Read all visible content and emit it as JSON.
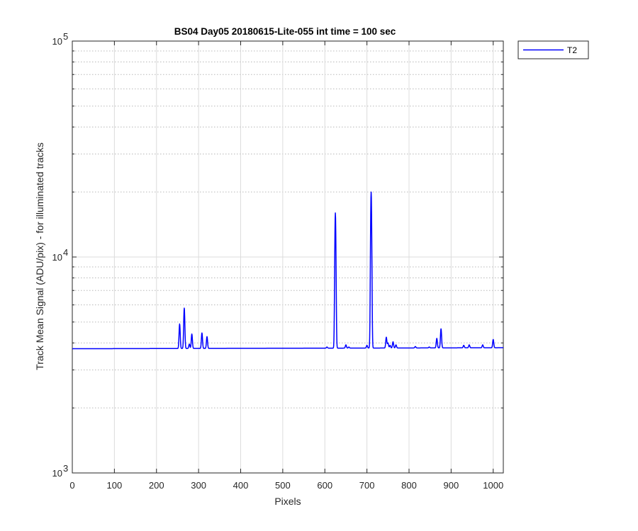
{
  "chart_data": {
    "type": "line",
    "title": "BS04 Day05 20180615-Lite-055 int time = 100 sec",
    "xlabel": "Pixels",
    "ylabel": "Track Mean Signal (ADU/pix) - for illuminated tracks",
    "xlim": [
      0,
      1024
    ],
    "ylim": [
      1000,
      100000
    ],
    "yscale": "log",
    "x_ticks": [
      0,
      100,
      200,
      300,
      400,
      500,
      600,
      700,
      800,
      900,
      1000
    ],
    "x_tick_labels": [
      "0",
      "100",
      "200",
      "300",
      "400",
      "500",
      "600",
      "700",
      "800",
      "900",
      "1000"
    ],
    "y_major_ticks": [
      1000,
      10000,
      100000
    ],
    "y_tick_labels": [
      {
        "base": "10",
        "exp": "3"
      },
      {
        "base": "10",
        "exp": "4"
      },
      {
        "base": "10",
        "exp": "5"
      }
    ],
    "grid": true,
    "minor_grid": true,
    "legend_position": "outside-top-right",
    "series": [
      {
        "name": "T2",
        "color": "#0000ff",
        "baseline_start": 3760,
        "baseline_end": 3800,
        "peaks": [
          {
            "x": 255,
            "y": 4900
          },
          {
            "x": 266,
            "y": 5800
          },
          {
            "x": 278,
            "y": 3950
          },
          {
            "x": 284,
            "y": 4400
          },
          {
            "x": 308,
            "y": 4450
          },
          {
            "x": 320,
            "y": 4280
          },
          {
            "x": 605,
            "y": 3830
          },
          {
            "x": 625,
            "y": 16000
          },
          {
            "x": 650,
            "y": 3920
          },
          {
            "x": 657,
            "y": 3830
          },
          {
            "x": 700,
            "y": 3900
          },
          {
            "x": 710,
            "y": 20000
          },
          {
            "x": 746,
            "y": 4250
          },
          {
            "x": 750,
            "y": 4000
          },
          {
            "x": 755,
            "y": 3900
          },
          {
            "x": 762,
            "y": 4050
          },
          {
            "x": 769,
            "y": 3920
          },
          {
            "x": 815,
            "y": 3850
          },
          {
            "x": 848,
            "y": 3830
          },
          {
            "x": 866,
            "y": 4200
          },
          {
            "x": 876,
            "y": 4650
          },
          {
            "x": 930,
            "y": 3900
          },
          {
            "x": 943,
            "y": 3920
          },
          {
            "x": 975,
            "y": 3920
          },
          {
            "x": 1000,
            "y": 4150
          }
        ]
      }
    ]
  }
}
